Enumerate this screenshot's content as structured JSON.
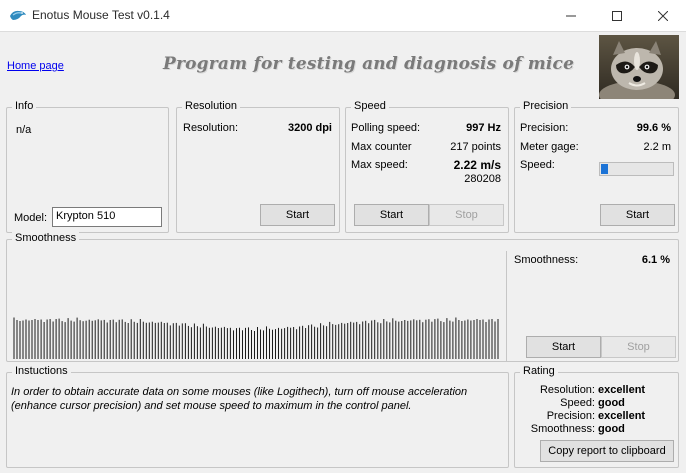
{
  "window": {
    "title": "Enotus Mouse Test v0.1.4"
  },
  "header": {
    "home_link": "Home page",
    "headline": "Program for testing and diagnosis of mice"
  },
  "info": {
    "legend": "Info",
    "status": "n/a",
    "model_label": "Model:",
    "model_value": "Krypton 510"
  },
  "resolution": {
    "legend": "Resolution",
    "label": "Resolution:",
    "value": "3200 dpi",
    "start_label": "Start"
  },
  "speed": {
    "legend": "Speed",
    "polling_label": "Polling speed:",
    "polling_value": "997 Hz",
    "counter_label": "Max counter",
    "counter_value": "217 points",
    "max_speed_label": "Max  speed:",
    "max_speed_value": "2.22 m/s",
    "max_speed_raw": "280208",
    "start_label": "Start",
    "stop_label": "Stop"
  },
  "precision": {
    "legend": "Precision",
    "precision_label": "Precision:",
    "precision_value": "99.6 %",
    "gage_label": "Meter gage:",
    "gage_value": "2.2 m",
    "speed_label": "Speed:",
    "speed_level": 0.1,
    "start_label": "Start"
  },
  "smoothness": {
    "legend": "Smoothness",
    "label": "Smoothness:",
    "value": "6.1 %",
    "start_label": "Start",
    "stop_label": "Stop"
  },
  "instructions": {
    "legend": "Instuctions",
    "text": "In order to obtain accurate data on some mouses (like Logithech), turn off mouse acceleration (enhance cursor precision) and set mouse speed to maximum in the control panel."
  },
  "rating": {
    "legend": "Rating",
    "rows": [
      {
        "label": "Resolution:",
        "value": "excellent"
      },
      {
        "label": "Speed:",
        "value": "good"
      },
      {
        "label": "Precision:",
        "value": "excellent"
      },
      {
        "label": "Smoothness:",
        "value": "good"
      }
    ],
    "copy_label": "Copy report to clipboard"
  },
  "colors": {
    "link": "#0000ee",
    "progress": "#1c73d6",
    "headline": "#7a7a7a"
  },
  "icons": {
    "app": "bird-icon",
    "minimize": "minimize-icon",
    "maximize": "maximize-icon",
    "close": "close-icon"
  }
}
